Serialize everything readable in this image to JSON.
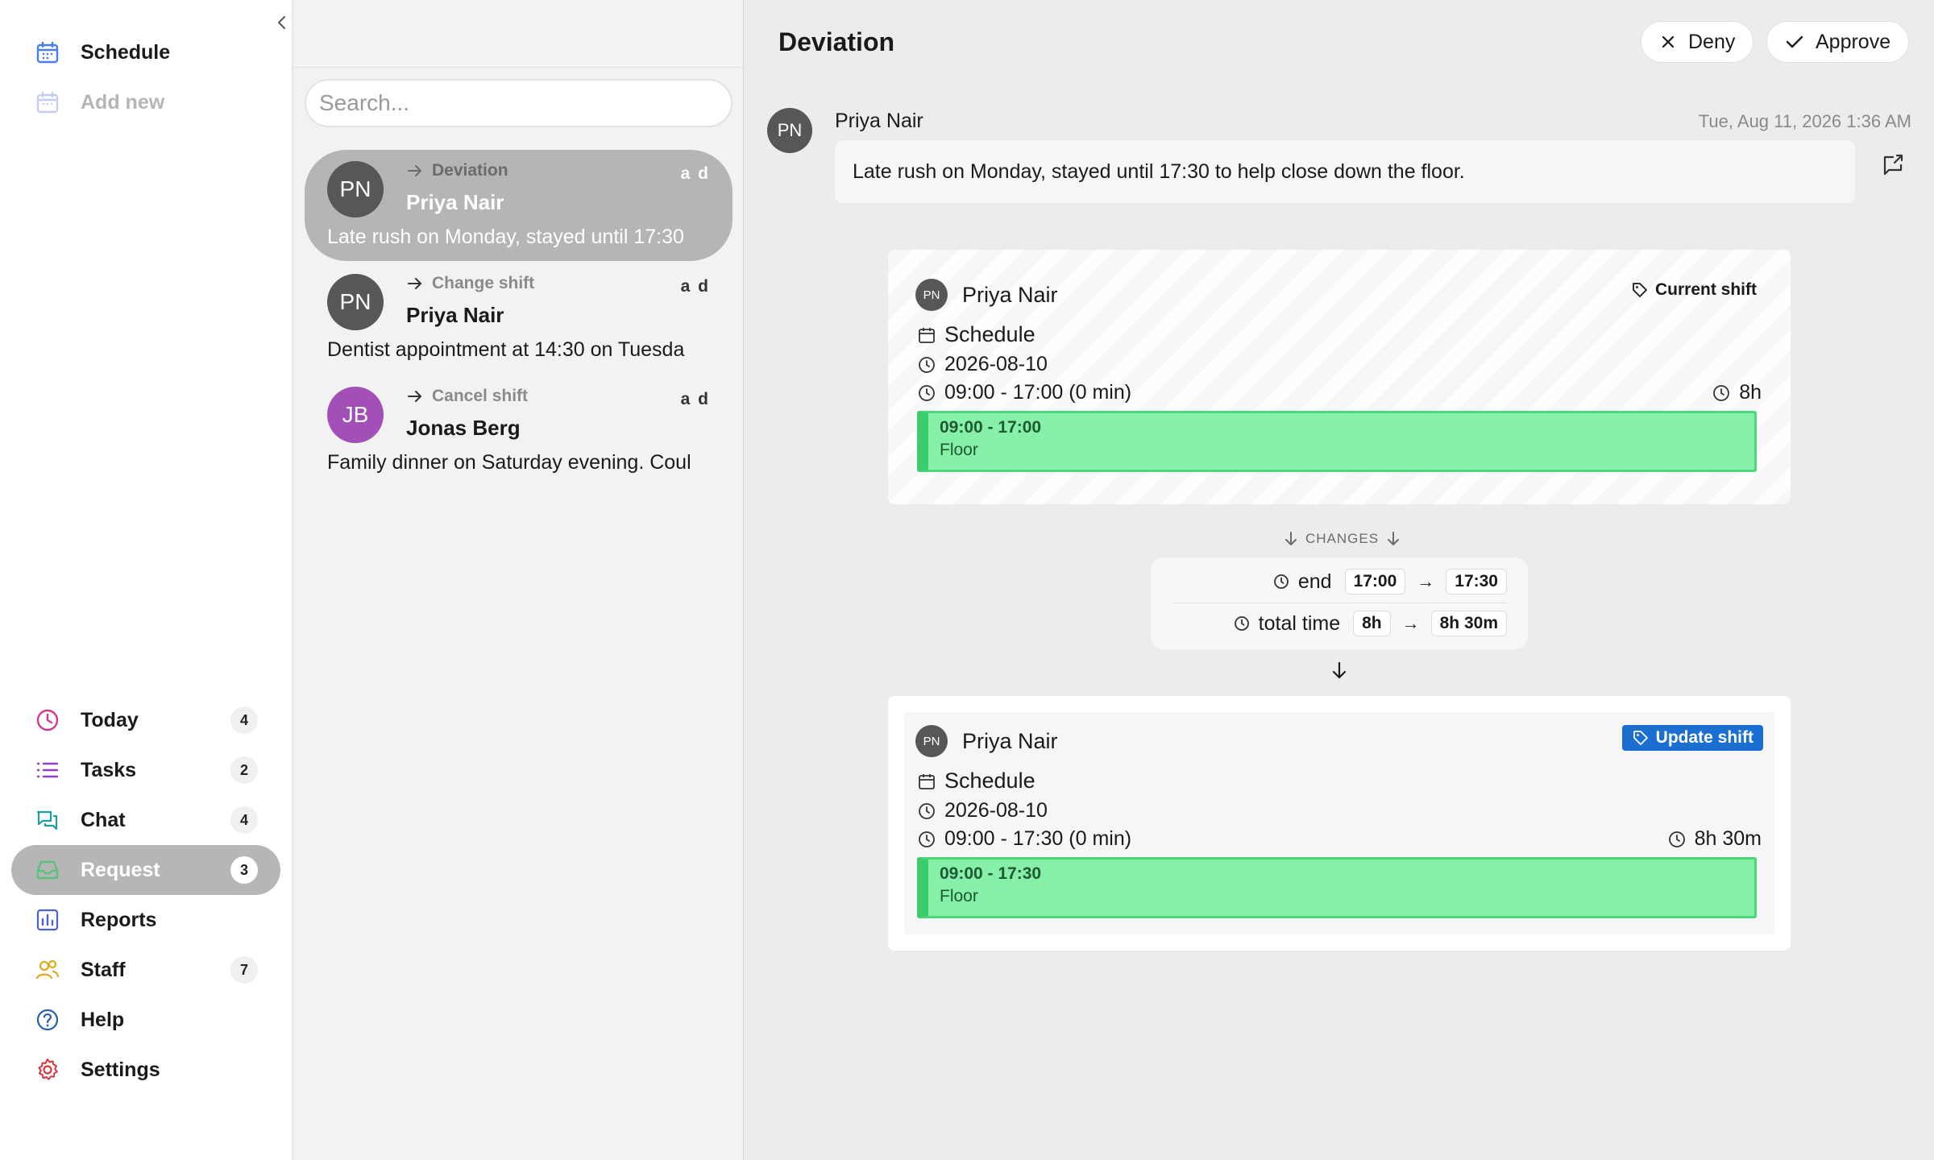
{
  "sidebar": {
    "top_items": [
      {
        "label": "Schedule",
        "icon": "calendar-icon"
      },
      {
        "label": "Add new",
        "icon": "calendar-plus-icon"
      }
    ],
    "bottom_items": [
      {
        "label": "Today",
        "count": "4",
        "icon": "clock-icon"
      },
      {
        "label": "Tasks",
        "count": "2",
        "icon": "list-icon"
      },
      {
        "label": "Chat",
        "count": "4",
        "icon": "chat-icon"
      },
      {
        "label": "Request",
        "count": "3",
        "icon": "inbox-icon"
      },
      {
        "label": "Reports",
        "icon": "bar-chart-icon"
      },
      {
        "label": "Staff",
        "count": "7",
        "icon": "users-icon"
      },
      {
        "label": "Help",
        "icon": "help-icon"
      },
      {
        "label": "Settings",
        "icon": "gear-icon"
      }
    ]
  },
  "list": {
    "search_placeholder": "Search...",
    "requests": [
      {
        "initials": "PN",
        "type": "Deviation",
        "age": "a d",
        "name": "Priya Nair",
        "snippet": "Late rush on Monday, stayed until 17:30",
        "avatar_color": "#575757"
      },
      {
        "initials": "PN",
        "type": "Change shift",
        "age": "a d",
        "name": "Priya Nair",
        "snippet": "Dentist appointment at 14:30 on Tuesda",
        "avatar_color": "#575757"
      },
      {
        "initials": "JB",
        "type": "Cancel shift",
        "age": "a d",
        "name": "Jonas Berg",
        "snippet": "Family dinner on Saturday evening. Coul",
        "avatar_color": "#a34fb8"
      }
    ]
  },
  "detail": {
    "title": "Deviation",
    "deny_label": "Deny",
    "approve_label": "Approve",
    "message": {
      "initials": "PN",
      "author": "Priya Nair",
      "timestamp": "Tue, Aug 11, 2026 1:36 AM",
      "text": "Late rush on Monday, stayed until 17:30 to help close down the floor."
    },
    "current_shift": {
      "initials": "PN",
      "name": "Priya Nair",
      "tag": "Current shift",
      "schedule": "Schedule",
      "date": "2026-08-10",
      "time": "09:00 - 17:00 (0 min)",
      "duration": "8h",
      "block_time": "09:00 - 17:00",
      "block_label": "Floor"
    },
    "changes": {
      "header": "CHANGES",
      "end_key": "end",
      "end_from": "17:00",
      "end_to": "17:30",
      "total_key": "total time",
      "total_from": "8h",
      "total_to": "8h 30m",
      "arrow": "→"
    },
    "updated_shift": {
      "initials": "PN",
      "name": "Priya Nair",
      "tag": "Update shift",
      "schedule": "Schedule",
      "date": "2026-08-10",
      "time": "09:00 - 17:30 (0 min)",
      "duration": "8h 30m",
      "block_time": "09:00 - 17:30",
      "block_label": "Floor"
    }
  },
  "colors": {
    "accent_blue": "#1a6fd1",
    "shift_green": "#86efa8",
    "active_nav": "#b6b6b6"
  }
}
